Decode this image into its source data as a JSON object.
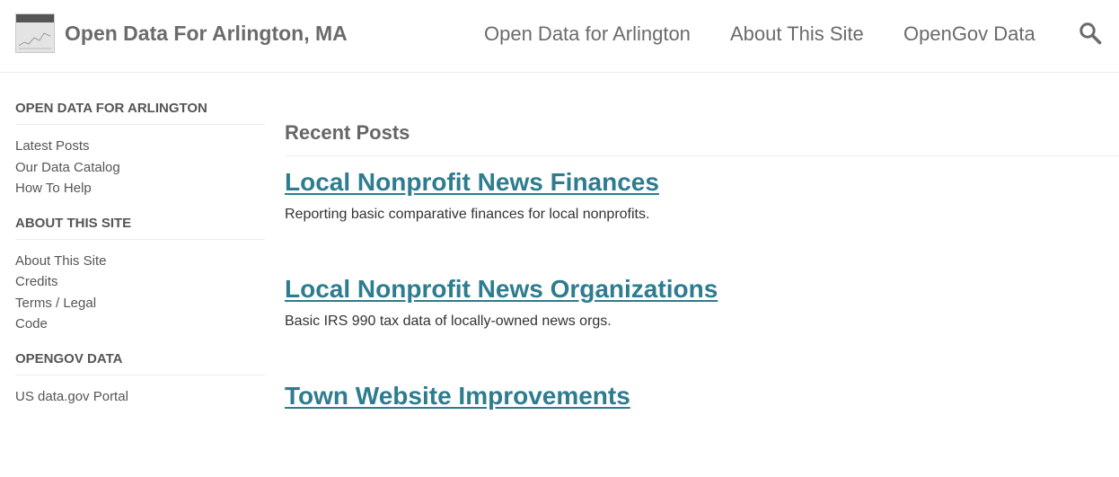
{
  "header": {
    "site_title": "Open Data For Arlington, MA",
    "nav": [
      {
        "label": "Open Data for Arlington"
      },
      {
        "label": "About This Site"
      },
      {
        "label": "OpenGov Data"
      }
    ],
    "search_icon": "search-icon"
  },
  "sidebar": {
    "sections": [
      {
        "heading": "OPEN DATA FOR ARLINGTON",
        "items": [
          "Latest Posts",
          "Our Data Catalog",
          "How To Help"
        ]
      },
      {
        "heading": "ABOUT THIS SITE",
        "items": [
          "About This Site",
          "Credits",
          "Terms / Legal",
          "Code"
        ]
      },
      {
        "heading": "OPENGOV DATA",
        "items": [
          "US data.gov Portal"
        ]
      }
    ]
  },
  "main": {
    "heading": "Recent Posts",
    "posts": [
      {
        "title": "Local Nonprofit News Finances",
        "summary": "Reporting basic comparative finances for local nonprofits."
      },
      {
        "title": "Local Nonprofit News Organizations",
        "summary": "Basic IRS 990 tax data of locally-owned news orgs."
      },
      {
        "title": "Town Website Improvements",
        "summary": ""
      }
    ]
  },
  "colors": {
    "link": "#2e7c8f",
    "text": "#333333",
    "muted": "#6b6b6b"
  }
}
